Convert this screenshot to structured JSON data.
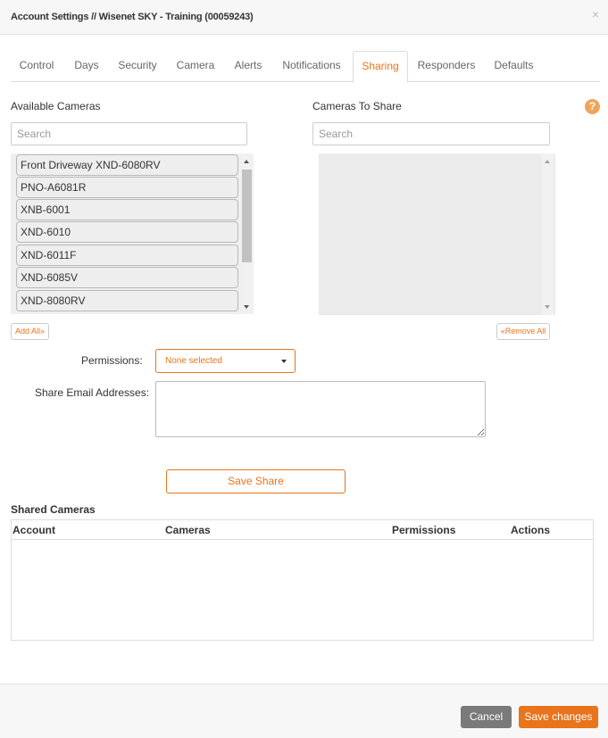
{
  "modal": {
    "title": "Account Settings // Wisenet SKY - Training (00059243)",
    "close_symbol": "×"
  },
  "tabs": [
    {
      "label": "Control"
    },
    {
      "label": "Days"
    },
    {
      "label": "Security"
    },
    {
      "label": "Camera"
    },
    {
      "label": "Alerts"
    },
    {
      "label": "Notifications"
    },
    {
      "label": "Sharing",
      "active": true
    },
    {
      "label": "Responders"
    },
    {
      "label": "Defaults"
    }
  ],
  "available": {
    "label": "Available Cameras",
    "search_placeholder": "Search",
    "cameras": [
      "Front Driveway XND-6080RV",
      "PNO-A6081R",
      "XNB-6001",
      "XND-6010",
      "XND-6011F",
      "XND-6085V",
      "XND-8080RV"
    ],
    "add_all_label": "Add All»"
  },
  "to_share": {
    "label": "Cameras To Share",
    "search_placeholder": "Search",
    "remove_all_label": "«Remove All"
  },
  "help_icon": "?",
  "permissions": {
    "label": "Permissions:",
    "selected": "None selected"
  },
  "email": {
    "label": "Share Email Addresses:"
  },
  "save_share_label": "Save Share",
  "shared": {
    "title": "Shared Cameras",
    "columns": [
      "Account",
      "Cameras",
      "Permissions",
      "Actions"
    ]
  },
  "footer": {
    "cancel_label": "Cancel",
    "save_label": "Save changes"
  },
  "colors": {
    "accent": "#e8741c",
    "cancel_bg": "#7a7a7a"
  }
}
